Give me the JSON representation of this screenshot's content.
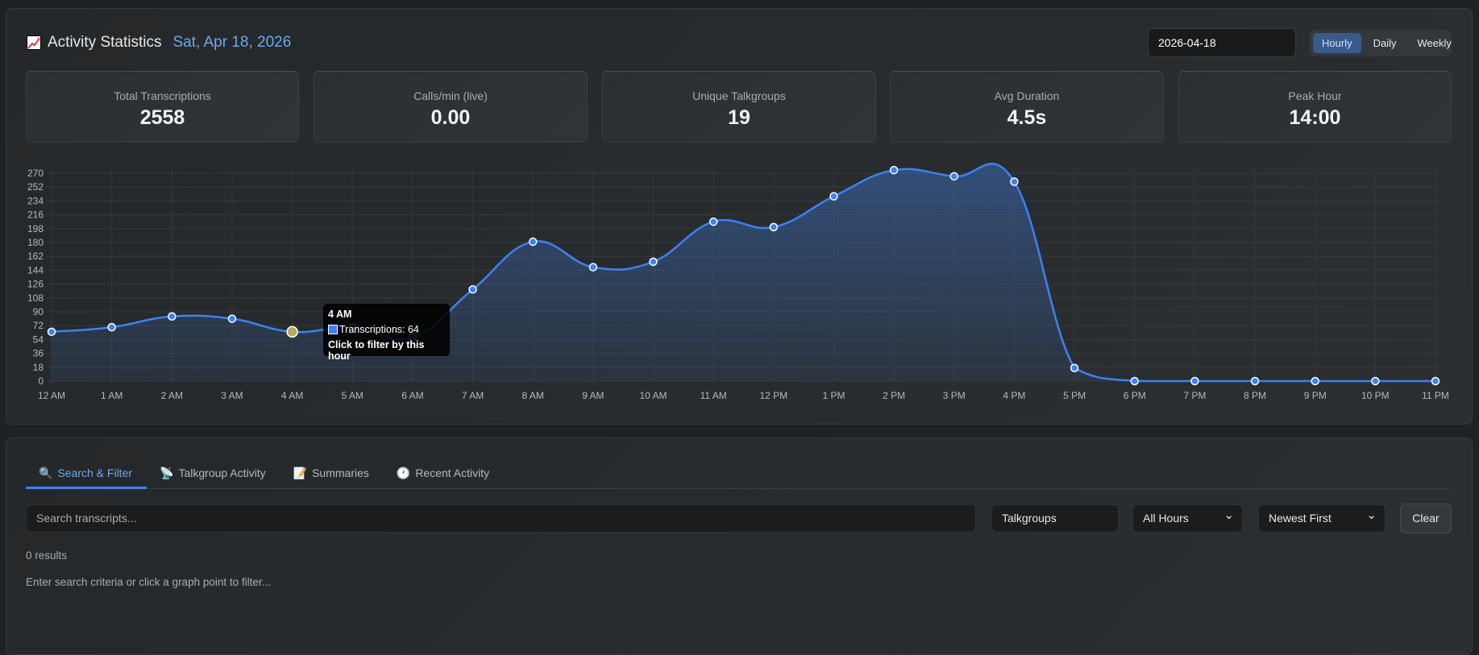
{
  "header": {
    "icon": "chart-increasing-icon",
    "title": "Activity Statistics",
    "date": "Sat, Apr 18, 2026",
    "date_input": "2026-04-18",
    "views": [
      "Hourly",
      "Daily",
      "Weekly"
    ],
    "active_view": "Hourly"
  },
  "stats": [
    {
      "label": "Total Transcriptions",
      "value": "2558"
    },
    {
      "label": "Calls/min (live)",
      "value": "0.00"
    },
    {
      "label": "Unique Talkgroups",
      "value": "19"
    },
    {
      "label": "Avg Duration",
      "value": "4.5s"
    },
    {
      "label": "Peak Hour",
      "value": "14:00"
    }
  ],
  "chart_data": {
    "type": "line",
    "title": "",
    "xlabel": "",
    "ylabel": "",
    "ylim": [
      0,
      270
    ],
    "yticks": [
      0,
      18,
      36,
      54,
      72,
      90,
      108,
      126,
      144,
      162,
      180,
      198,
      216,
      234,
      252,
      270
    ],
    "categories": [
      "12 AM",
      "1 AM",
      "2 AM",
      "3 AM",
      "4 AM",
      "5 AM",
      "6 AM",
      "7 AM",
      "8 AM",
      "9 AM",
      "10 AM",
      "11 AM",
      "12 PM",
      "1 PM",
      "2 PM",
      "3 PM",
      "4 PM",
      "5 PM",
      "6 PM",
      "7 PM",
      "8 PM",
      "9 PM",
      "10 PM",
      "11 PM"
    ],
    "series": [
      {
        "name": "Transcriptions",
        "color": "#3b82f6",
        "values": [
          64,
          70,
          84,
          81,
          64,
          70,
          57,
          119,
          181,
          148,
          155,
          207,
          200,
          240,
          274,
          266,
          259,
          17,
          0,
          0,
          0,
          0,
          0,
          0
        ]
      }
    ],
    "highlight_index": 4,
    "grid": true
  },
  "tooltip": {
    "title": "4 AM",
    "line": "Transcriptions: 64",
    "footer": "Click to filter by this hour"
  },
  "tabs": [
    {
      "label": "Search & Filter",
      "icon": "magnifier-icon"
    },
    {
      "label": "Talkgroup Activity",
      "icon": "satellite-antenna-icon"
    },
    {
      "label": "Summaries",
      "icon": "memo-icon"
    },
    {
      "label": "Recent Activity",
      "icon": "clock-icon"
    }
  ],
  "filters": {
    "search_placeholder": "Search transcripts...",
    "talkgroups": "Talkgroups",
    "hours": "All Hours",
    "sort": "Newest First",
    "clear": "Clear"
  },
  "results": {
    "count": "0 results",
    "hint": "Enter search criteria or click a graph point to filter..."
  }
}
